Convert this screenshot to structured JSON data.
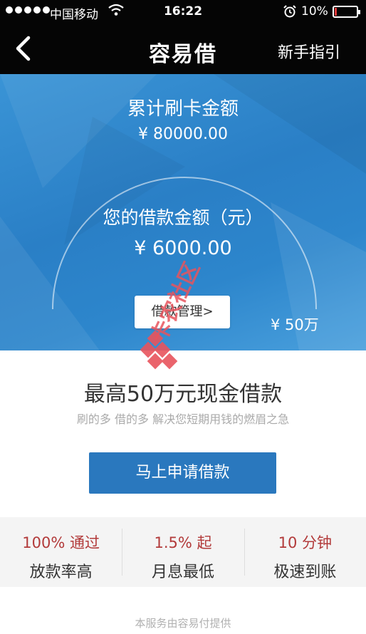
{
  "status_bar": {
    "carrier": "中国移动",
    "time": "16:22",
    "battery": "10%",
    "battery_level": 0.1,
    "battery_color": "#e23a3a"
  },
  "nav": {
    "back_icon": "chevron-left-icon",
    "title": "容易借",
    "guide_label": "新手指引"
  },
  "hero": {
    "total_label": "累计刷卡金额",
    "total_amount": "¥ 80000.00",
    "loan_label": "您的借款金额（元）",
    "loan_amount": "¥ 6000.00",
    "manage_label": "借款管理>",
    "max_label": "¥ 50万",
    "bg_color": "#2a7fc6"
  },
  "watermark": {
    "text": "卡农社区"
  },
  "promo": {
    "headline": "最高50万元现金借款",
    "subtitle": "刷的多 借的多 解决您短期用钱的燃眉之急",
    "apply_label": "马上申请借款",
    "accent": "#2a78be"
  },
  "features": [
    {
      "highlight": "100% 通过",
      "desc": "放款率高"
    },
    {
      "highlight": "1.5% 起",
      "desc": "月息最低"
    },
    {
      "highlight": "10 分钟",
      "desc": "极速到账"
    }
  ],
  "footer": {
    "note": "本服务由容易付提供"
  }
}
